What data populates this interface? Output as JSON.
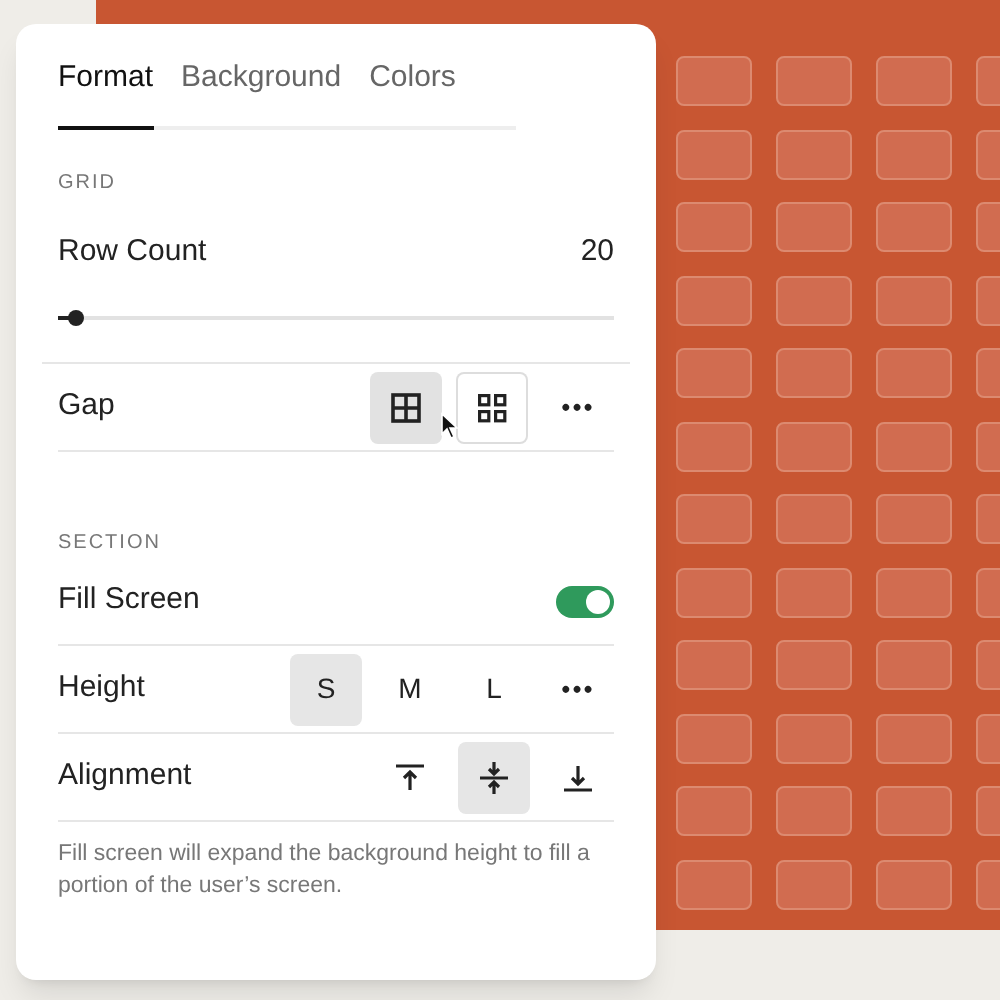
{
  "tabs": [
    {
      "label": "Format",
      "selected": true
    },
    {
      "label": "Background",
      "selected": false
    },
    {
      "label": "Colors",
      "selected": false
    }
  ],
  "grid": {
    "heading": "GRID",
    "row_count": {
      "label": "Row Count",
      "value": "20",
      "level": 0.02
    },
    "gap": {
      "label": "Gap",
      "options": [
        {
          "kind": "grid-joined",
          "selected": true,
          "hovered": false
        },
        {
          "kind": "grid-spaced",
          "selected": false,
          "hovered": true
        }
      ],
      "more": "•••"
    }
  },
  "section": {
    "heading": "SECTION",
    "fill_screen": {
      "label": "Fill Screen",
      "on": true
    },
    "height": {
      "label": "Height",
      "options": [
        {
          "label": "S",
          "selected": true
        },
        {
          "label": "M",
          "selected": false
        },
        {
          "label": "L",
          "selected": false
        }
      ],
      "more": "•••"
    },
    "alignment": {
      "label": "Alignment",
      "options": [
        {
          "kind": "top",
          "selected": false
        },
        {
          "kind": "middle",
          "selected": true
        },
        {
          "kind": "bottom",
          "selected": false
        }
      ]
    },
    "help": "Fill screen will expand the background height to fill a portion of the user’s screen."
  }
}
